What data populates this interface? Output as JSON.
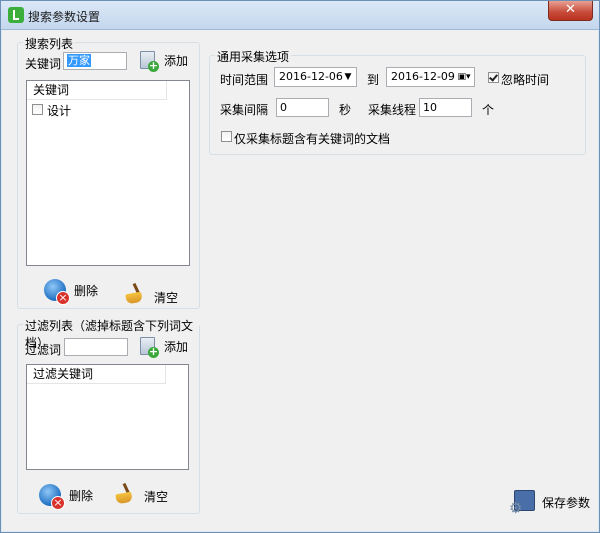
{
  "window": {
    "title": "搜索参数设置",
    "close_glyph": "✕"
  },
  "search_list": {
    "group_title": "搜索列表",
    "keyword_label": "关键词",
    "keyword_value": "万家",
    "add_label": "添加",
    "list_header": "关键词",
    "items": [
      {
        "label": "设计",
        "checked": false
      }
    ],
    "delete_label": "删除",
    "clear_label": "清空"
  },
  "filter_list": {
    "group_title": "过滤列表（滤掉标题含下列词文档）",
    "filter_label": "过滤词",
    "filter_value": "",
    "add_label": "添加",
    "list_header": "过滤关键词",
    "delete_label": "删除",
    "clear_label": "清空"
  },
  "options": {
    "group_title": "通用采集选项",
    "time_range_label": "时间范围",
    "date_from": "2016-12-06",
    "to_label": "到",
    "date_to": "2016-12-09",
    "ignore_time_label": "忽略时间",
    "ignore_time_checked": true,
    "interval_label": "采集间隔",
    "interval_value": "0",
    "seconds_label": "秒",
    "threads_label": "采集线程",
    "threads_value": "10",
    "threads_unit": "个",
    "title_only_label": "仅采集标题含有关键词的文档",
    "title_only_checked": false
  },
  "save_label": "保存参数"
}
